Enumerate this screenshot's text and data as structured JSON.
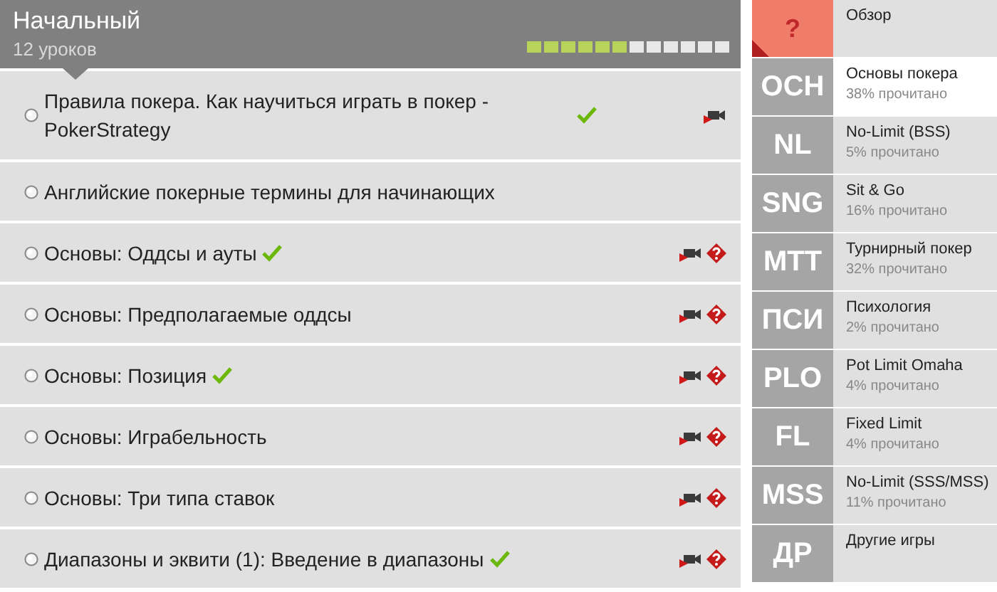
{
  "course": {
    "title": "Начальный",
    "subtitle": "12 уроков",
    "progress": {
      "level": 0.5
    }
  },
  "lessons": [
    {
      "title": "Правила покера. Как научиться играть в покер - PokerStrategy",
      "selected": false,
      "done": true,
      "video": true,
      "quiz": false
    },
    {
      "title": "Английские покерные термины для начинающих",
      "selected": false,
      "done": false,
      "video": false,
      "quiz": false
    },
    {
      "title": "Основы: Оддсы и ауты",
      "selected": false,
      "done": true,
      "video": true,
      "quiz": true
    },
    {
      "title": "Основы: Предполагаемые оддсы",
      "selected": false,
      "done": false,
      "video": true,
      "quiz": true
    },
    {
      "title": "Основы: Позиция",
      "selected": false,
      "done": true,
      "video": true,
      "quiz": true
    },
    {
      "title": "Основы: Играбельность",
      "selected": false,
      "done": false,
      "video": true,
      "quiz": true
    },
    {
      "title": "Основы: Три типа ставок",
      "selected": false,
      "done": false,
      "video": true,
      "quiz": true
    },
    {
      "title": "Диапазоны и эквити (1): Введение в диапазоны",
      "selected": false,
      "done": true,
      "video": true,
      "quiz": true
    }
  ],
  "sidebar": [
    {
      "kind": "overview",
      "abbr": "?",
      "title": "Обзор",
      "selected": false
    },
    {
      "kind": "section",
      "abbr": "ОСН",
      "title": "Основы покера",
      "read": "38% прочитано",
      "selected": true
    },
    {
      "kind": "section",
      "abbr": "NL",
      "title": "No-Limit (BSS)",
      "read": "5% прочитано",
      "selected": false
    },
    {
      "kind": "section",
      "abbr": "SNG",
      "title": "Sit & Go",
      "read": "16% прочитано",
      "selected": false
    },
    {
      "kind": "section",
      "abbr": "MTT",
      "title": "Турнирный покер",
      "read": "32% прочитано",
      "selected": false
    },
    {
      "kind": "section",
      "abbr": "ПСИ",
      "title": "Психология",
      "read": "2% прочитано",
      "selected": false
    },
    {
      "kind": "section",
      "abbr": "PLO",
      "title": "Pot Limit Omaha",
      "read": "4% прочитано",
      "selected": false
    },
    {
      "kind": "section",
      "abbr": "FL",
      "title": "Fixed Limit",
      "read": "4% прочитано",
      "selected": false
    },
    {
      "kind": "section",
      "abbr": "MSS",
      "title": "No-Limit (SSS/MSS)",
      "read": "11% прочитано",
      "selected": false
    },
    {
      "kind": "section",
      "abbr": "ДР",
      "title": "Другие игры",
      "selected": false
    }
  ]
}
